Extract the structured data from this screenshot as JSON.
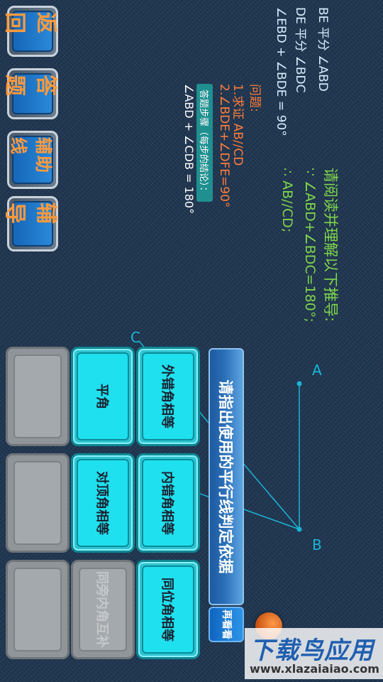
{
  "side_buttons": [
    {
      "label": "返回"
    },
    {
      "label": "答题"
    },
    {
      "label": "辅助线"
    },
    {
      "label": "辅导"
    }
  ],
  "given": [
    "BE 平分 ∠ABD",
    "DE 平分 ∠BDC",
    "∠EBD + ∠BDE = 90°"
  ],
  "question_heading": "问题:",
  "questions": [
    "1.求证 AB//CD",
    "2.∠BDE+∠DFE=90°"
  ],
  "steps_badge": "答题步骤（每步的结论）：",
  "step_line": "∠ABD + ∠CDB = 180°",
  "reasoning": {
    "heading": "请阅读并理解以下推导:",
    "line1": "∵ ∠ABD+∠BDC=180°;",
    "line2": "∴ AB//CD;"
  },
  "diagram_labels": {
    "a": "A",
    "b": "B",
    "c": "C"
  },
  "prompt_bar": "请指出使用的平行线判定依据",
  "reread_button": "再看看",
  "answer_tiles": [
    [
      "外错角相等",
      "内错角相等",
      "同位角相等"
    ],
    [
      "平角",
      "对顶角相等",
      "同旁内角互补"
    ]
  ],
  "colors": {
    "accent_blue": "#2a88d8",
    "button_text": "#ff9a3c",
    "tile_cyan": "#1fe0ee",
    "tile_grey": "#a4a9ad",
    "green_text": "#7fd64a",
    "orange_text": "#ff7d3a"
  },
  "watermark": {
    "main": "下载鸟应用",
    "url": "www.xlazaiaiao.com"
  }
}
